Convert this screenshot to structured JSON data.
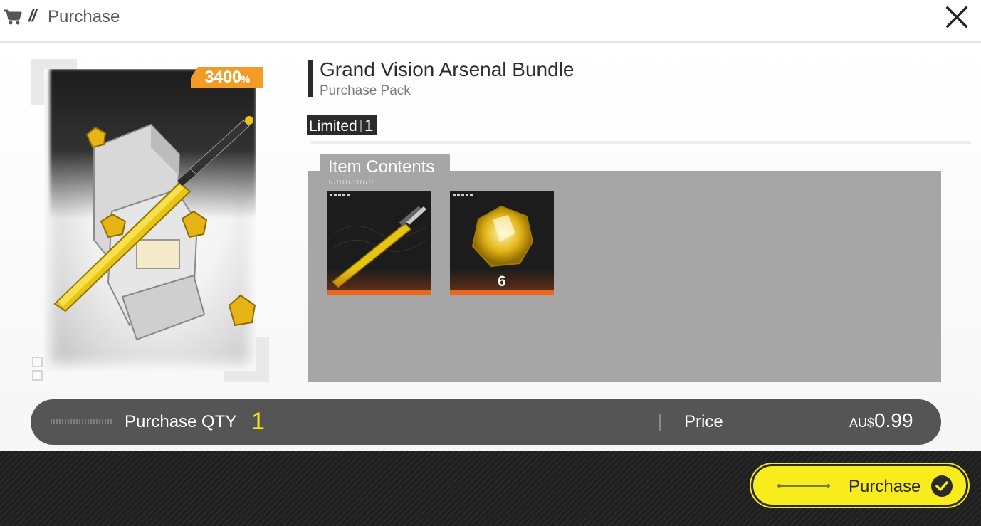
{
  "header": {
    "slash": "//",
    "title": "Purchase",
    "cart_icon": "cart-icon",
    "close_icon": "close-icon"
  },
  "product": {
    "badge_value": "3400",
    "badge_suffix": "%",
    "title": "Grand Vision Arsenal Bundle",
    "subtitle": "Purchase Pack",
    "limited_label": "Limited",
    "limited_count": "1"
  },
  "contents": {
    "label": "Item Contents",
    "items": [
      {
        "icon": "golden-sword-icon",
        "quantity": ""
      },
      {
        "icon": "gold-crystal-icon",
        "quantity": "6"
      }
    ]
  },
  "purchase_bar": {
    "qty_label": "Purchase QTY",
    "qty_value": "1",
    "price_label": "Price",
    "currency": "AU$",
    "price": "0.99"
  },
  "footer": {
    "purchase_label": "Purchase",
    "check_icon": "checkmark-icon"
  },
  "colors": {
    "accent_yellow": "#f9ec1c",
    "badge_orange": "#f29b25",
    "rarity_orange": "#e8671e",
    "panel_gray": "#a6a6a6",
    "bar_gray": "#555555"
  }
}
